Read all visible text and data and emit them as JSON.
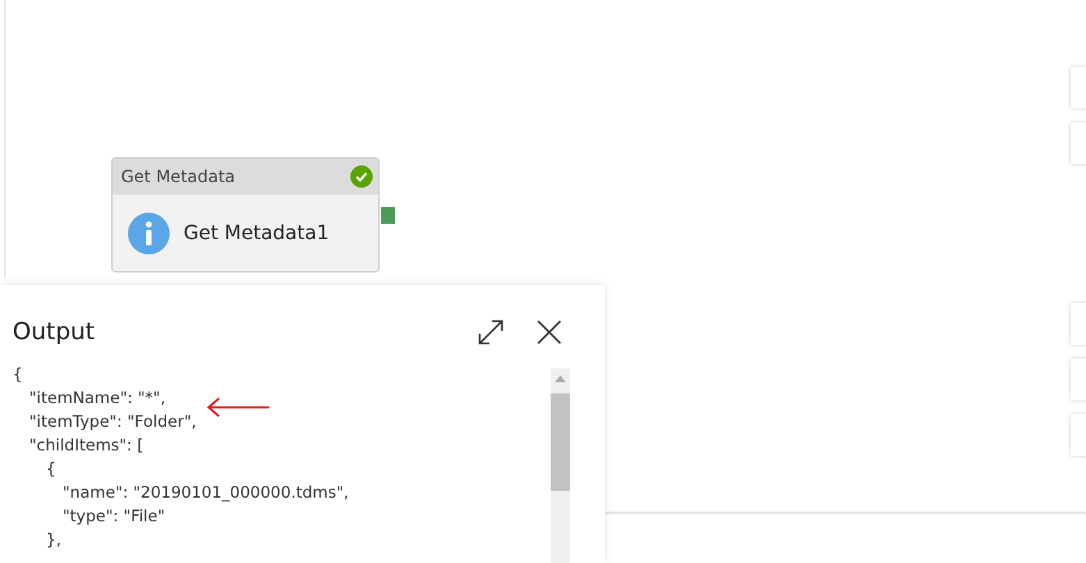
{
  "activity": {
    "type": "Get Metadata",
    "name": "Get Metadata1",
    "succeeded": true
  },
  "output": {
    "title": "Output",
    "lines": [
      {
        "text": "{",
        "children": [
          {
            "text": "\"itemName\": \"*\","
          },
          {
            "text": "\"itemType\": \"Folder\","
          },
          {
            "text": "\"childItems\": [",
            "children": [
              {
                "text": "{",
                "children": [
                  {
                    "text": "\"name\": \"20190101_000000.tdms\","
                  },
                  {
                    "text": "\"type\": \"File\""
                  }
                ]
              },
              {
                "text": "},"
              }
            ]
          }
        ]
      }
    ]
  }
}
